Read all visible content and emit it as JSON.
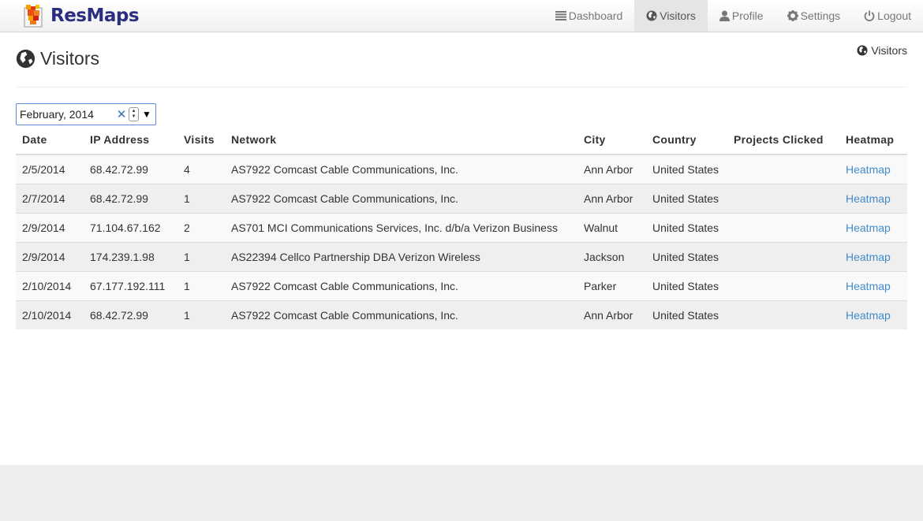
{
  "brand": {
    "name": "ResMaps"
  },
  "nav": [
    {
      "label": "Dashboard",
      "icon": "list-icon"
    },
    {
      "label": "Visitors",
      "icon": "globe-icon",
      "active": true
    },
    {
      "label": "Profile",
      "icon": "user-icon"
    },
    {
      "label": "Settings",
      "icon": "gear-icon"
    },
    {
      "label": "Logout",
      "icon": "power-icon"
    }
  ],
  "page": {
    "title": "Visitors",
    "breadcrumb": "Visitors"
  },
  "month_picker": {
    "value": "February, 2014"
  },
  "table": {
    "headers": [
      "Date",
      "IP Address",
      "Visits",
      "Network",
      "City",
      "Country",
      "Projects Clicked",
      "Heatmap"
    ],
    "rows": [
      {
        "date": "2/5/2014",
        "ip": "68.42.72.99",
        "visits": "4",
        "network": "AS7922 Comcast Cable Communications, Inc.",
        "city": "Ann Arbor",
        "country": "United States",
        "projects": "",
        "heatmap": "Heatmap"
      },
      {
        "date": "2/7/2014",
        "ip": "68.42.72.99",
        "visits": "1",
        "network": "AS7922 Comcast Cable Communications, Inc.",
        "city": "Ann Arbor",
        "country": "United States",
        "projects": "",
        "heatmap": "Heatmap"
      },
      {
        "date": "2/9/2014",
        "ip": "71.104.67.162",
        "visits": "2",
        "network": "AS701 MCI Communications Services, Inc. d/b/a Verizon Business",
        "city": "Walnut",
        "country": "United States",
        "projects": "",
        "heatmap": "Heatmap"
      },
      {
        "date": "2/9/2014",
        "ip": "174.239.1.98",
        "visits": "1",
        "network": "AS22394 Cellco Partnership DBA Verizon Wireless",
        "city": "Jackson",
        "country": "United States",
        "projects": "",
        "heatmap": "Heatmap"
      },
      {
        "date": "2/10/2014",
        "ip": "67.177.192.111",
        "visits": "1",
        "network": "AS7922 Comcast Cable Communications, Inc.",
        "city": "Parker",
        "country": "United States",
        "projects": "",
        "heatmap": "Heatmap"
      },
      {
        "date": "2/10/2014",
        "ip": "68.42.72.99",
        "visits": "1",
        "network": "AS7922 Comcast Cable Communications, Inc.",
        "city": "Ann Arbor",
        "country": "United States",
        "projects": "",
        "heatmap": "Heatmap"
      }
    ]
  },
  "colors": {
    "brand_text": "#2b2e7e",
    "link": "#428bca",
    "active_nav_bg": "#e5e5e5"
  }
}
